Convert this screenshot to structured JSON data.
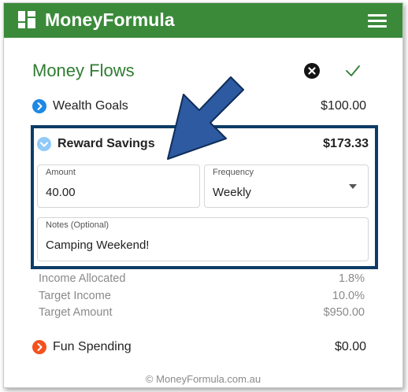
{
  "app": {
    "title": "MoneyFormula",
    "brand_color": "#3a8a3a"
  },
  "page": {
    "title": "Money Flows",
    "actions": {
      "close": "close-circle-icon",
      "confirm": "check-icon"
    }
  },
  "flows": [
    {
      "label": "Wealth Goals",
      "amount": "$100.00",
      "chevron_color": "#1e88e5",
      "state": "collapsed"
    },
    {
      "label": "Reward Savings",
      "amount": "$173.33",
      "chevron_color": "#90caf9",
      "state": "expanded"
    },
    {
      "label": "Fun Spending",
      "amount": "$0.00",
      "chevron_color": "#f4511e",
      "state": "collapsed"
    }
  ],
  "editor": {
    "amount": {
      "label": "Amount",
      "value": "40.00"
    },
    "frequency": {
      "label": "Frequency",
      "value": "Weekly"
    },
    "notes": {
      "label": "Notes (Optional)",
      "value": "Camping Weekend!"
    }
  },
  "stats": [
    {
      "label": "Income Allocated",
      "value": "1.8%"
    },
    {
      "label": "Target Income",
      "value": "10.0%"
    },
    {
      "label": "Target Amount",
      "value": "$950.00"
    }
  ],
  "footer": {
    "text": "© MoneyFormula.com.au"
  },
  "colors": {
    "highlight_border": "#0d3d66",
    "annotation_arrow": "#2d5aa0",
    "title_green": "#2f7d32"
  }
}
